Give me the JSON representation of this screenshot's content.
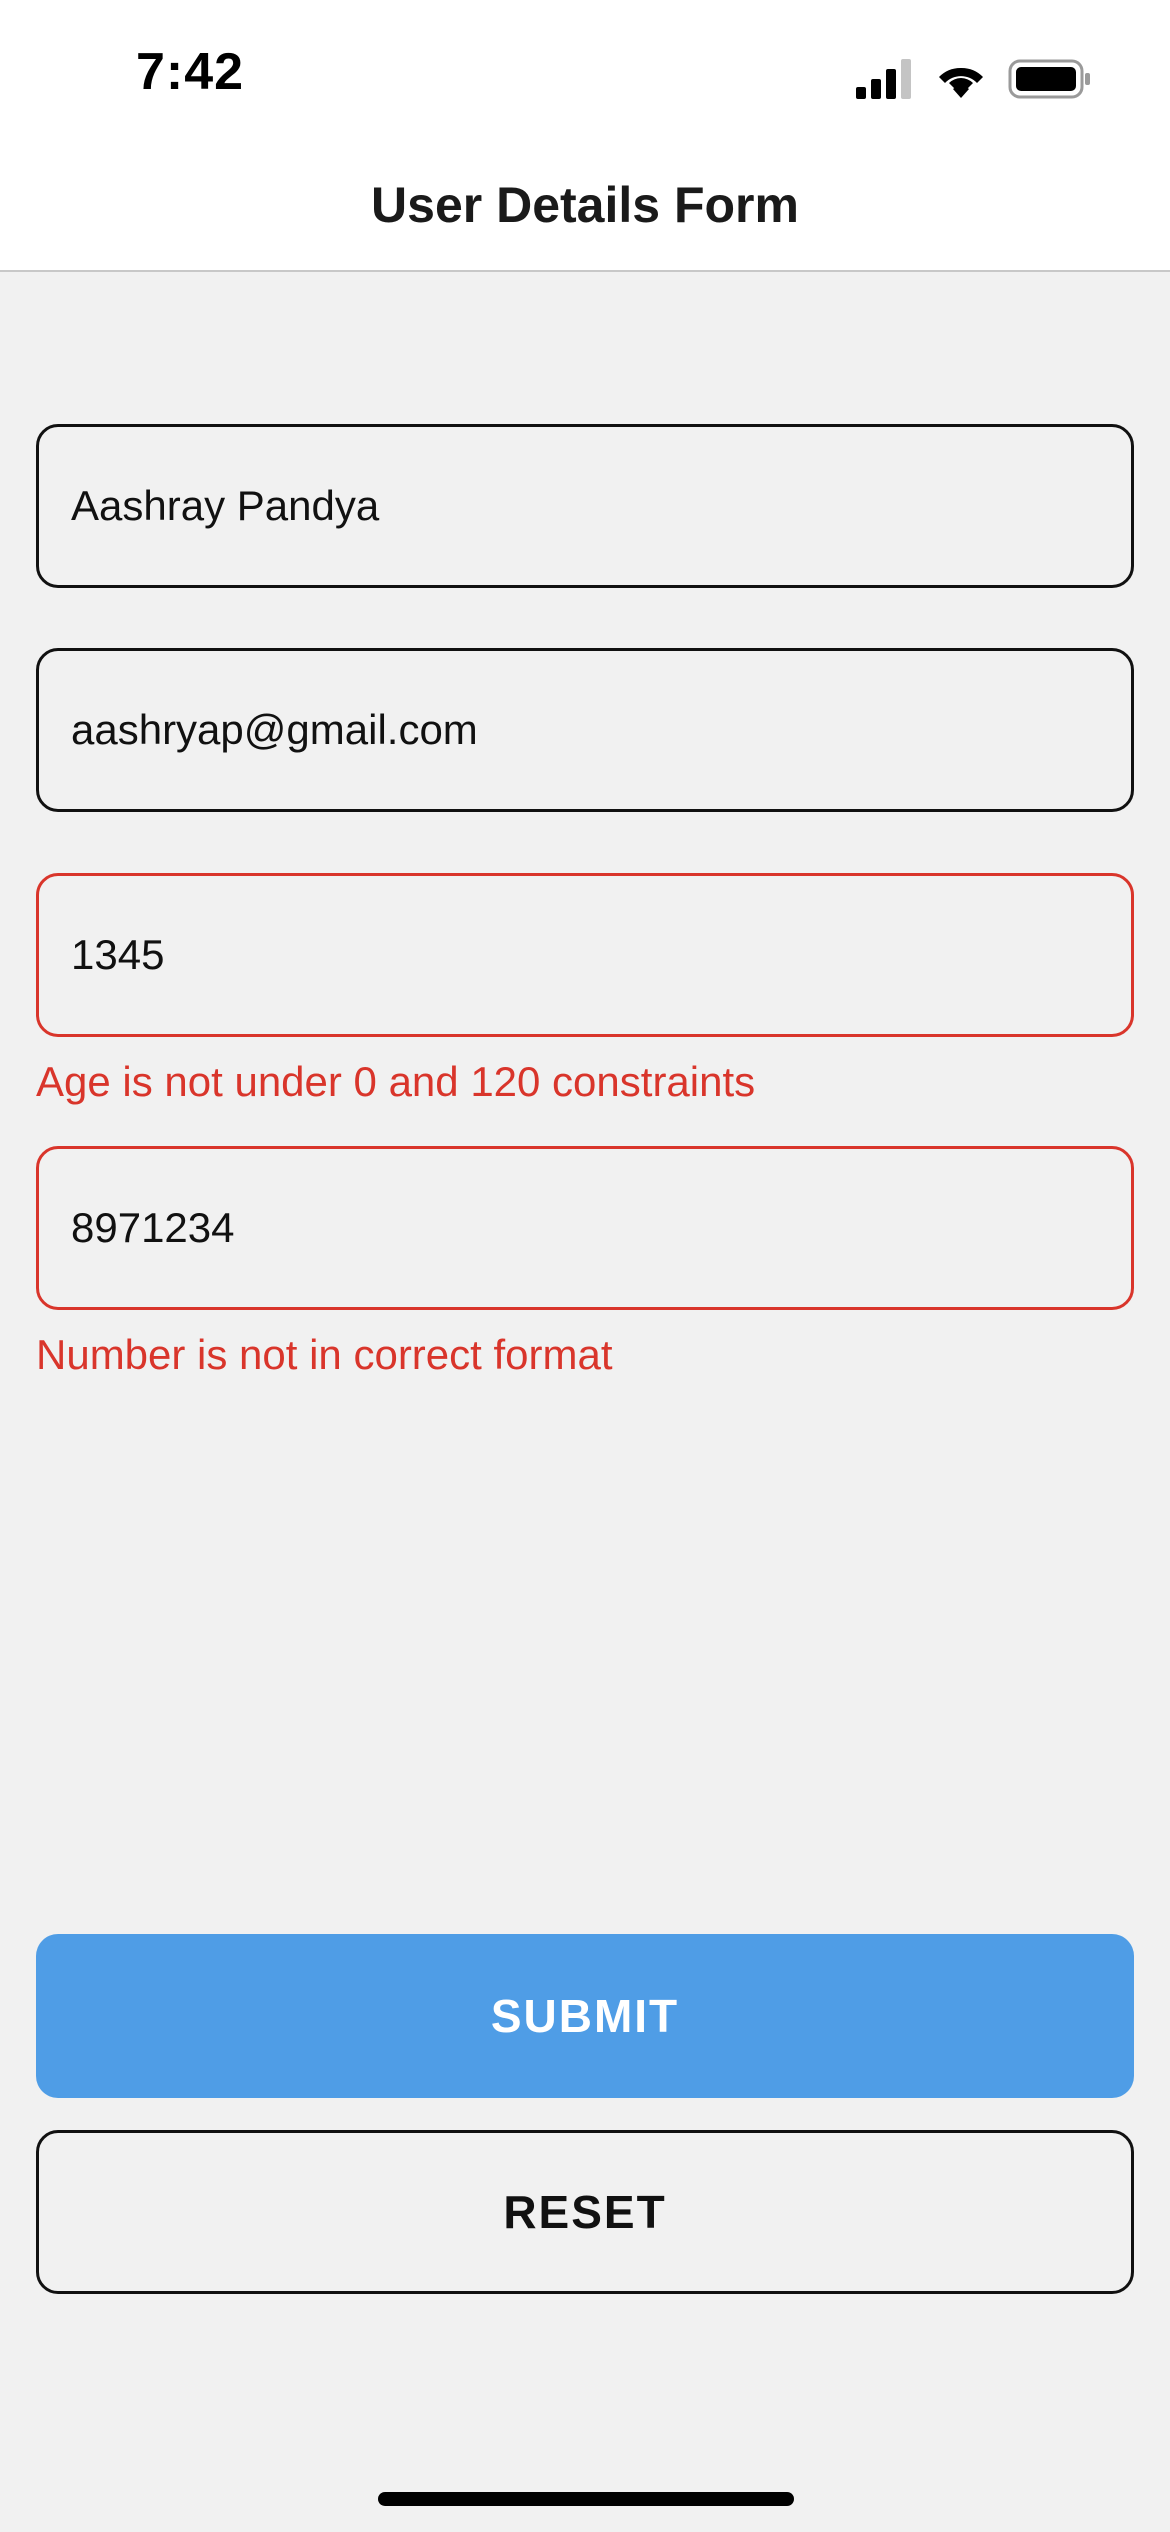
{
  "status_bar": {
    "time": "7:42",
    "icons": [
      "cellular-signal-icon",
      "wifi-icon",
      "battery-icon"
    ]
  },
  "header": {
    "title": "User Details Form"
  },
  "form": {
    "name_value": "Aashray Pandya",
    "email_value": "aashryap@gmail.com",
    "age_value": "1345",
    "age_error": "Age is not under 0 and 120 constraints",
    "phone_value": "8971234",
    "phone_error": "Number is not in correct format"
  },
  "actions": {
    "submit_label": "SUBMIT",
    "reset_label": "RESET"
  },
  "colors": {
    "accent": "#4f9de6",
    "error": "#d9352b",
    "background": "#f1f1f1"
  }
}
